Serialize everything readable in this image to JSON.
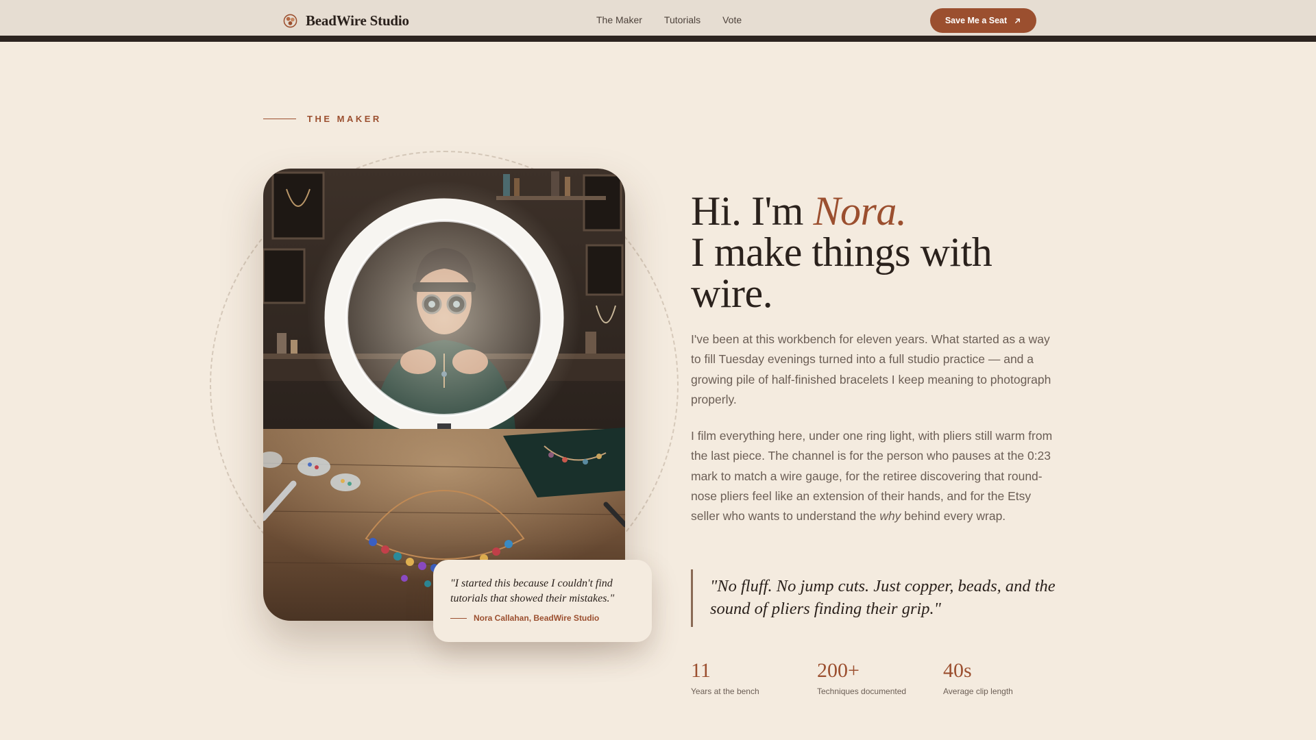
{
  "header": {
    "brand_name": "BeadWire Studio",
    "nav": [
      "The Maker",
      "Tutorials",
      "Vote"
    ],
    "cta_label": "Save Me a Seat"
  },
  "section": {
    "eyebrow": "THE MAKER"
  },
  "headline": {
    "greeting": "Hi. I'm ",
    "name": "Nora.",
    "line2": "I make things with wire."
  },
  "intro": {
    "p1": "I've been at this workbench for eleven years. What started as a way to fill Tuesday evenings turned into a full studio practice — and a growing pile of half-finished bracelets I keep meaning to photograph properly.",
    "p2_before": "I film everything here, under one ring light, with pliers still warm from the last piece. The channel is for the person who pauses at the 0:23 mark to match a wire gauge, for the retiree discovering that round-nose pliers feel like an extension of their hands, and for the Etsy seller who wants to understand the ",
    "p2_emphasis": "why",
    "p2_after": " behind every wrap."
  },
  "pull_quote": "\"No fluff. No jump cuts. Just copper, beads, and the sound of pliers finding their grip.\"",
  "photo_quote": {
    "text": "\"I started this because I couldn't find tutorials that showed their mistakes.\"",
    "attribution": "Nora Callahan, BeadWire Studio"
  },
  "stats": [
    {
      "value": "11",
      "label": "Years at the bench"
    },
    {
      "value": "200+",
      "label": "Techniques documented"
    },
    {
      "value": "40s",
      "label": "Average clip length"
    }
  ],
  "colors": {
    "background": "#f4ebdf",
    "header": "#e6ddd2",
    "accent": "#9b4f2f",
    "ink": "#2a211c",
    "muted": "#6b5e55"
  },
  "icons": {
    "brand": "bead-cluster-icon",
    "cta": "arrow-up-right-icon"
  }
}
